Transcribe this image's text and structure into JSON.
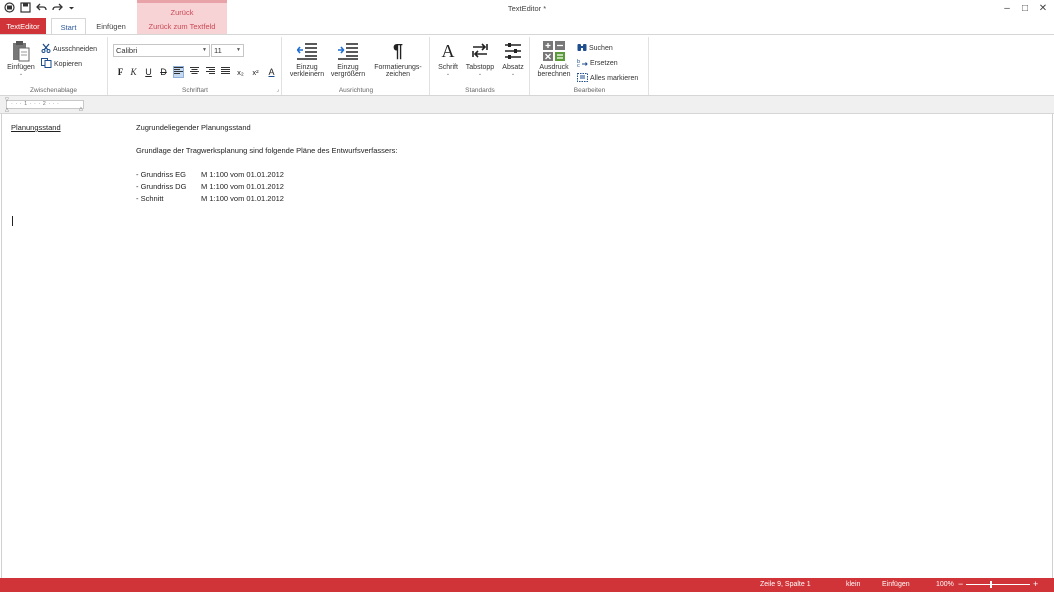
{
  "window": {
    "title": "TextEditor *",
    "context_group": "Zurück",
    "controls": [
      "–",
      "□",
      "✕"
    ]
  },
  "qat_icons": [
    "printer-icon",
    "save-icon",
    "undo-icon",
    "redo-icon",
    "qat-dropdown-icon"
  ],
  "tabs": {
    "app": "TextEditor",
    "start": "Start",
    "insert": "Einfügen",
    "back": "Zurück zum Textfeld"
  },
  "ribbon": {
    "clipboard": {
      "label": "Zwischenablage",
      "paste": "Einfügen",
      "cut": "Ausschneiden",
      "copy": "Kopieren"
    },
    "font": {
      "label": "Schriftart",
      "font_name": "Calibri",
      "font_size": "11",
      "bold": "F",
      "italic": "K",
      "underline": "U",
      "strike": "D",
      "subscript": "x₂",
      "superscript": "x²",
      "font_color": "A"
    },
    "alignment": {
      "label": "Ausrichtung",
      "decrease_indent_1": "Einzug",
      "decrease_indent_2": "verkleinern",
      "increase_indent_1": "Einzug",
      "increase_indent_2": "vergrößern",
      "formatting_marks_1": "Formatierungs-",
      "formatting_marks_2": "zeichen"
    },
    "standards": {
      "label": "Standards",
      "font": "Schrift",
      "tabstop": "Tabstopp",
      "paragraph": "Absatz"
    },
    "edit": {
      "label": "Bearbeiten",
      "calc_1": "Ausdruck",
      "calc_2": "berechnen",
      "search": "Suchen",
      "replace": "Ersetzen",
      "select_all": "Alles markieren"
    }
  },
  "ruler": {
    "marks": "· · · 1 · · · 2 · · ·"
  },
  "document": {
    "heading": "Planungsstand",
    "line1": "Zugrundeliegender Planungsstand",
    "line2": "Grundlage der Tragwerksplanung sind folgende Pläne des Entwurfsverfassers:",
    "items": [
      {
        "name": "- Grundriss EG",
        "detail": "M 1:100 vom 01.01.2012"
      },
      {
        "name": "- Grundriss DG",
        "detail": "M 1:100 vom 01.01.2012"
      },
      {
        "name": "- Schnitt",
        "detail": "M 1:100 vom 01.01.2012"
      }
    ]
  },
  "status": {
    "position": "Zeile 9, Spalte 1",
    "case": "klein",
    "mode": "Einfügen",
    "zoom": "100%",
    "zoom_minus": "−",
    "zoom_plus": "+"
  },
  "colors": {
    "accent": "#d13438",
    "context_band": "#f8d3d6",
    "context_text": "#c94a55",
    "tab_blue": "#2b579a"
  }
}
